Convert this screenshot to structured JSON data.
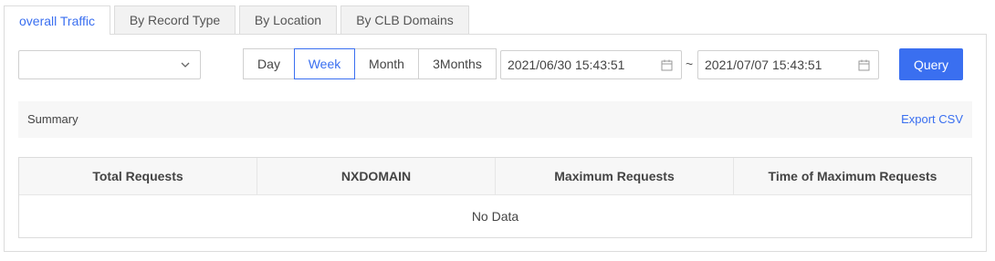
{
  "tabs": [
    {
      "label": "overall Traffic",
      "active": true
    },
    {
      "label": "By Record Type",
      "active": false
    },
    {
      "label": "By Location",
      "active": false
    },
    {
      "label": "By CLB Domains",
      "active": false
    }
  ],
  "filter": {
    "select_value": "",
    "ranges": [
      "Day",
      "Week",
      "Month",
      "3Months"
    ],
    "active_range": "Week",
    "start_date": "2021/06/30 15:43:51",
    "date_separator": "~",
    "end_date": "2021/07/07 15:43:51",
    "query_label": "Query"
  },
  "summary": {
    "title": "Summary",
    "export_label": "Export CSV"
  },
  "table": {
    "columns": [
      "Total Requests",
      "NXDOMAIN",
      "Maximum Requests",
      "Time of Maximum Requests"
    ],
    "empty_text": "No Data"
  },
  "colors": {
    "accent": "#3a6ff0",
    "border": "#dcdcdc",
    "header_bg": "#f7f7f7"
  }
}
